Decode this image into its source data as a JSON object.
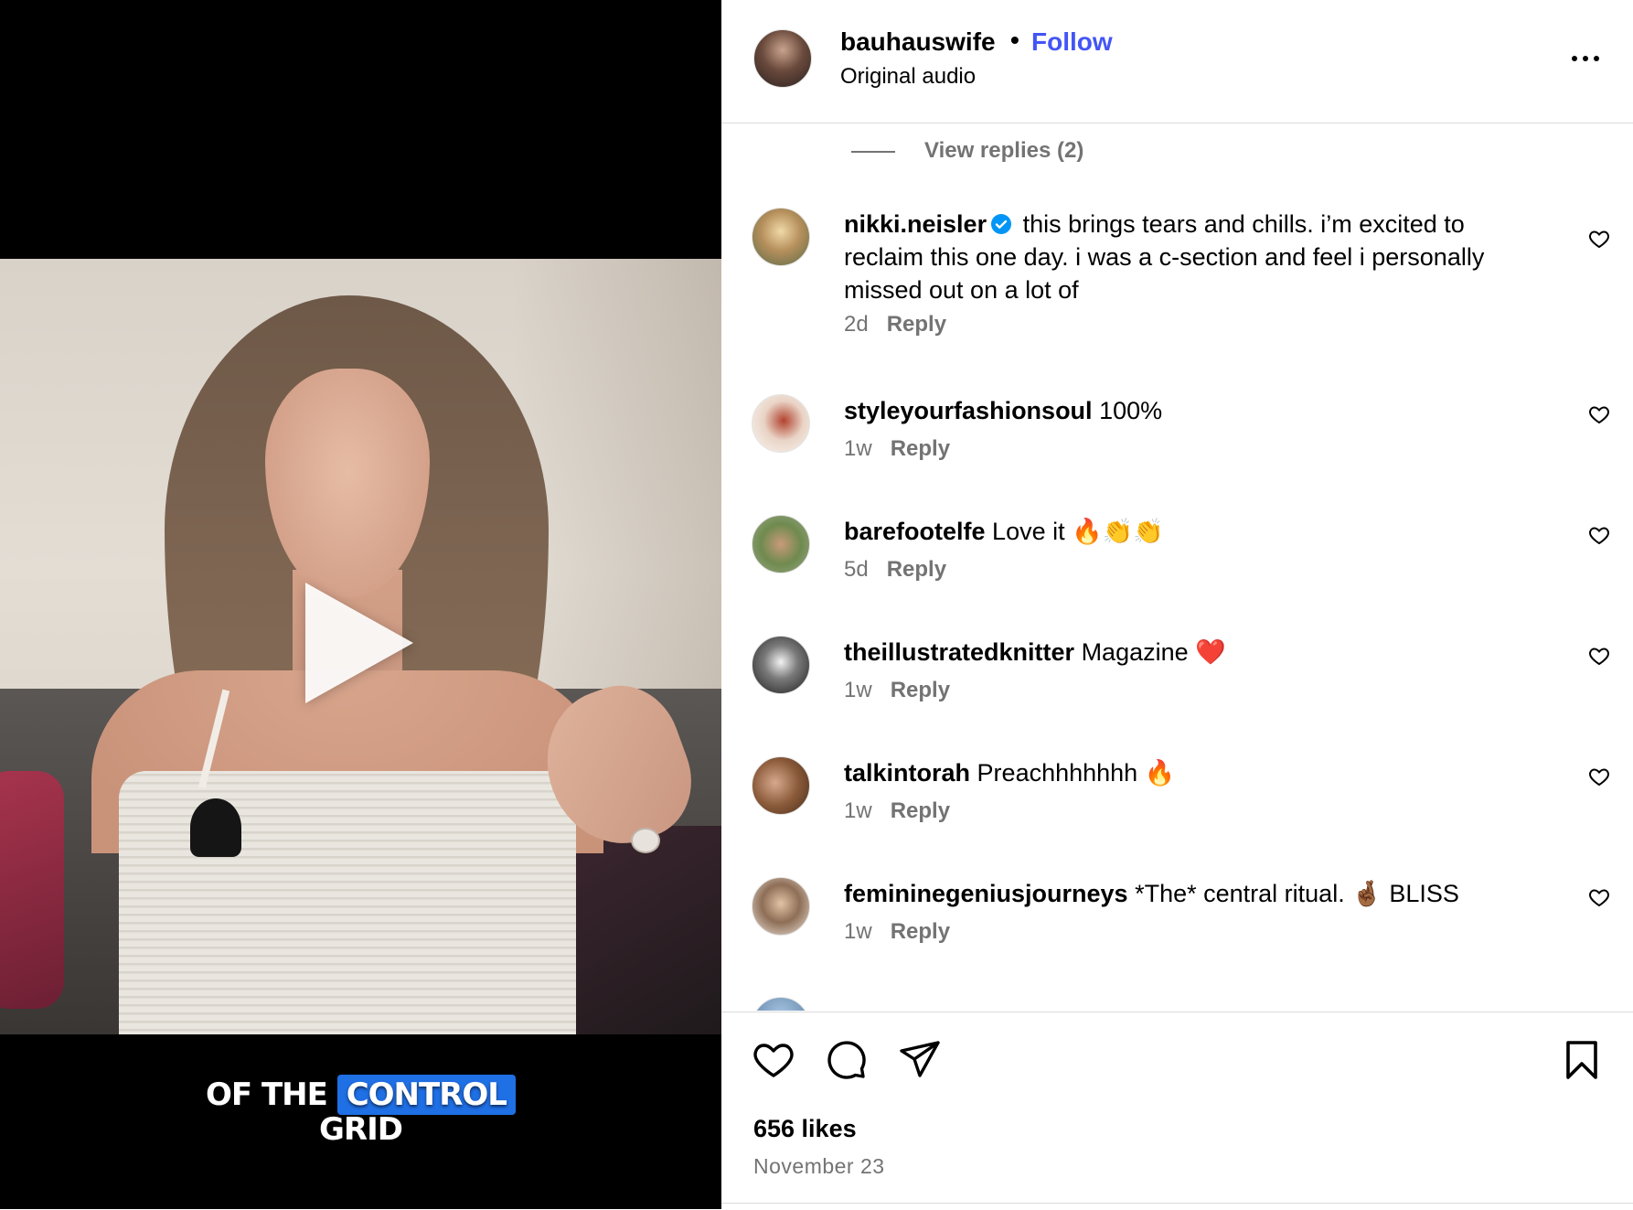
{
  "post": {
    "username": "bauhauswife",
    "separator": "•",
    "follow_label": "Follow",
    "audio": "Original audio",
    "more_icon": "more-horizontal-icon"
  },
  "video": {
    "caption_line1_prefix": "OF THE",
    "caption_line1_highlight": "CONTROL",
    "caption_line2": "GRID",
    "play_icon": "play-icon",
    "highlight_color": "#1f6fe5"
  },
  "replies": {
    "label": "View replies (2)"
  },
  "comments": [
    {
      "username": "nikki.neisler",
      "verified": true,
      "text": "this brings tears and chills. i’m excited to reclaim this one day. i was a c-section and feel i personally missed out on a lot of",
      "time": "2d",
      "reply_label": "Reply"
    },
    {
      "username": "styleyourfashionsoul",
      "verified": false,
      "text": "100%",
      "time": "1w",
      "reply_label": "Reply"
    },
    {
      "username": "barefootelfe",
      "verified": false,
      "text": "Love it 🔥👏👏",
      "time": "5d",
      "reply_label": "Reply"
    },
    {
      "username": "theillustratedknitter",
      "verified": false,
      "text": "Magazine ❤️",
      "time": "1w",
      "reply_label": "Reply"
    },
    {
      "username": "talkintorah",
      "verified": false,
      "text": "Preachhhhhhh 🔥",
      "time": "1w",
      "reply_label": "Reply"
    },
    {
      "username": "femininegeniusjourneys",
      "verified": false,
      "text": "*The* central ritual. 🤞🏾 BLISS",
      "time": "1w",
      "reply_label": "Reply"
    }
  ],
  "footer": {
    "likes": "656 likes",
    "date": "November 23",
    "icons": [
      "heart-icon",
      "comment-icon",
      "share-icon",
      "bookmark-icon"
    ]
  },
  "colors": {
    "link_blue": "#4355f5",
    "verified_blue": "#0095f6",
    "muted": "#737373",
    "divider": "#dbdbdb"
  }
}
